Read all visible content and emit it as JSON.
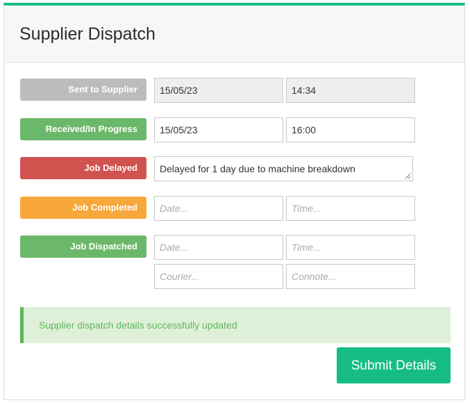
{
  "header": {
    "title": "Supplier Dispatch"
  },
  "colors": {
    "accent": "#16bd84",
    "sent": "#bcbcbc",
    "received": "#6cb86a",
    "delayed": "#d0534f",
    "completed": "#f8a83b",
    "dispatched": "#6cb86a"
  },
  "rows": {
    "sent": {
      "label": "Sent to Supplier",
      "date": "15/05/23",
      "time": "14:34"
    },
    "received": {
      "label": "Received/In Progress",
      "date": "15/05/23",
      "time": "16:00"
    },
    "delayed": {
      "label": "Job Delayed",
      "note": "Delayed for 1 day due to machine breakdown"
    },
    "completed": {
      "label": "Job Completed",
      "date_placeholder": "Date...",
      "time_placeholder": "Time..."
    },
    "dispatched": {
      "label": "Job Dispatched",
      "date_placeholder": "Date...",
      "time_placeholder": "Time...",
      "courier_placeholder": "Courier...",
      "connote_placeholder": "Connote..."
    }
  },
  "alert": {
    "message": "Supplier dispatch details successfully updated"
  },
  "submit": {
    "label": "Submit Details"
  }
}
